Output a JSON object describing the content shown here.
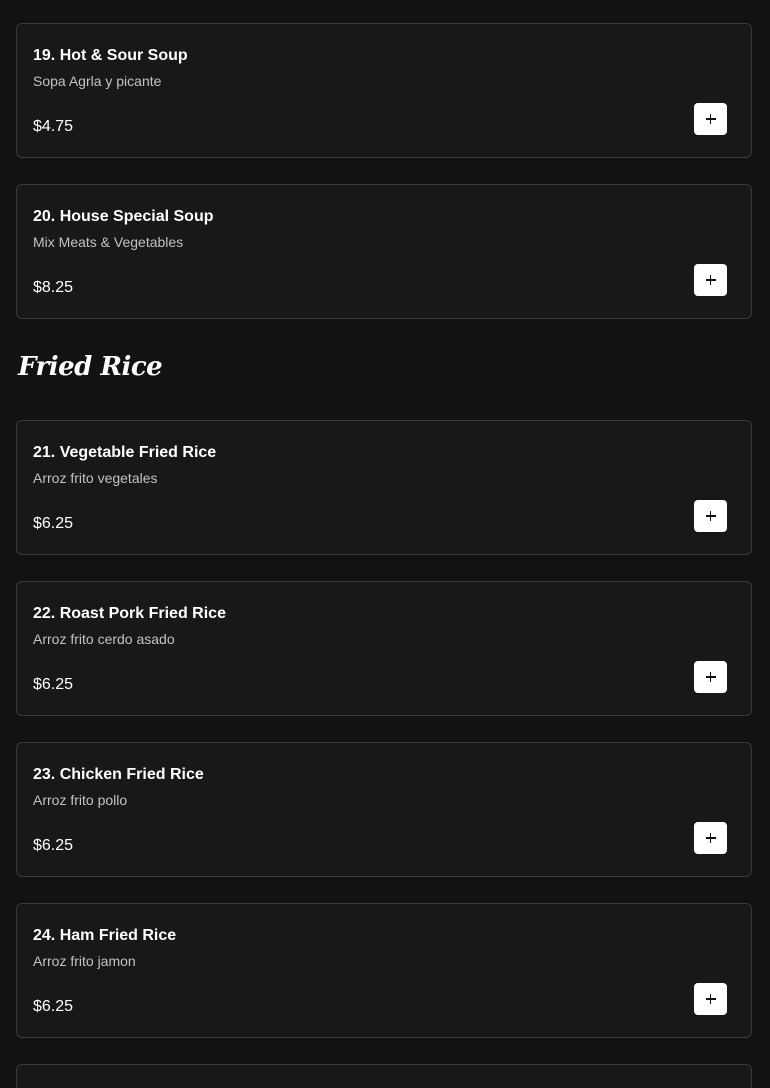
{
  "soups": {
    "items": [
      {
        "name": "19. Hot & Sour Soup",
        "description": "Sopa Agrla y picante",
        "price": "$4.75"
      },
      {
        "name": "20. House Special Soup",
        "description": "Mix Meats & Vegetables",
        "price": "$8.25"
      }
    ]
  },
  "fried_rice": {
    "title": "Fried Rice",
    "items": [
      {
        "name": "21. Vegetable Fried Rice",
        "description": "Arroz frito vegetales",
        "price": "$6.25"
      },
      {
        "name": "22. Roast Pork Fried Rice",
        "description": "Arroz frito cerdo asado",
        "price": "$6.25"
      },
      {
        "name": "23. Chicken Fried Rice",
        "description": "Arroz frito pollo",
        "price": "$6.25"
      },
      {
        "name": "24. Ham Fried Rice",
        "description": "Arroz frito jamon",
        "price": "$6.25"
      }
    ]
  },
  "icons": {
    "add": "plus-icon"
  },
  "colors": {
    "background": "#121212",
    "card_background": "#181818",
    "card_border": "#3a3a3a",
    "add_button": "#ffffff"
  }
}
